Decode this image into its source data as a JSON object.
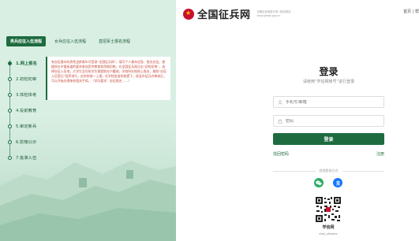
{
  "tabs": [
    "男兵应征入伍流程",
    "女兵应征入伍流程",
    "直招军士报名流程"
  ],
  "steps": [
    "1.网上报名",
    "2.初检初审",
    "3.体检体考",
    "4.役前教育",
    "5.审定新兵",
    "6.张榜公示",
    "7.批准入伍"
  ],
  "description": "有应征意向的男性适龄青年可登录“全国征兵网”，填写个人基本信息、报名应征。根据所在乡镇街道的要求参加宣传教育和资格初审。在全国征兵网点击“初检初审”，选择应征入伍地，大学生及在校学生需提前在户籍地、学校所在地网上报名，按照“应征入伍登记”程序进行，由学校统一上报。在学校批准的前提下，经县市征兵办审核后，可以开始办理体检相关手续。（学历要求：应征报名……）",
  "header": {
    "site_name": "全国征兵网",
    "subtitle_line1": "全国征兵网官方唯一指定网站",
    "subtitle_line2": "www.gfbzb.gov.cn",
    "links": "首页 | 帮"
  },
  "login": {
    "title": "登录",
    "subtitle": "请使用“学信网账号”进行登录",
    "phone_placeholder": "手机号/邮箱",
    "password_placeholder": "密码",
    "button": "登录",
    "forgot": "找回密码",
    "register": "注册",
    "other_methods": "其他登录方式",
    "qr_label": "学信网",
    "qr_sub": "chsi_chesicc"
  },
  "colors": {
    "brand_green": "#1e6b3f",
    "panel_bg": "#d9efe3",
    "desc_text": "#c74b3c"
  },
  "icons": {
    "wechat": "wechat-icon",
    "alipay": "alipay-icon"
  }
}
